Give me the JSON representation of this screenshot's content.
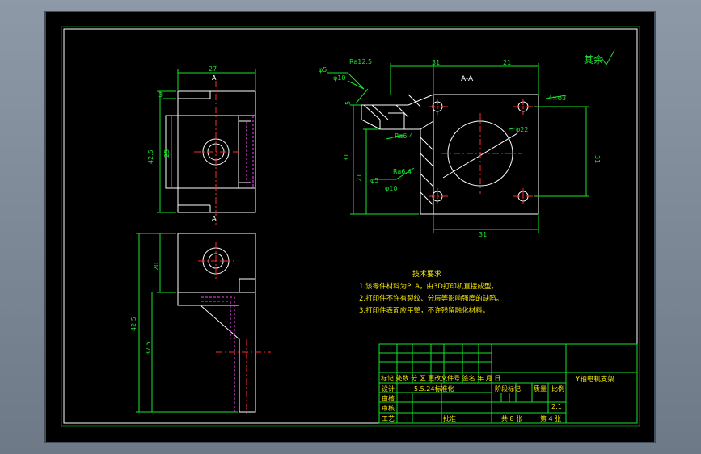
{
  "drawing": {
    "section_label": "A-A",
    "view_arrow_label": "A",
    "remaining_finish": "其余",
    "dimensions": {
      "top_width": "27",
      "top_d3": "3",
      "top_height": "42.5",
      "top_d25": "25",
      "side_20": "20",
      "side_42": "42.5",
      "side_37": "37.5",
      "sec_31a": "31",
      "sec_21a": "21",
      "sec_5": "5",
      "sec_31b": "31",
      "sec_21b": "21",
      "sec_31c": "31",
      "sec_31d": "31",
      "hole_4x": "4×φ3",
      "phi22": "φ22",
      "phi5a": "φ5",
      "phi10a": "φ10",
      "phi5b": "φ5",
      "phi10b": "φ10",
      "ra125": "Ra12.5",
      "ra64a": "Ra6.4",
      "ra64b": "Ra6.4"
    },
    "tech_title": "技术要求",
    "tech_notes": [
      "1.该零件材料为PLA，由3D打印机直接成型。",
      "2.打印件不许有裂纹、分层等影响强度的缺陷。",
      "3.打印件表面应平整，不许残留融化材料。"
    ]
  },
  "title_block": {
    "part_name": "Y轴电机支架",
    "header_row": "标记 处数 分 区 更改文件号 签名 年 月 日",
    "designer_label": "设计",
    "designer_info": "5.5.24标准化",
    "check_label": "审核",
    "process_label": "工艺",
    "approve_label": "批准",
    "stage_label": "阶段标记",
    "weight_label": "质量",
    "scale_label": "比例",
    "scale_value": "2:1",
    "sheets_total": "共 8 张",
    "sheet_no": "第 4 张",
    "extra_label": "审核"
  },
  "colors": {
    "background": "#000000",
    "frame": "#19e32b",
    "part_lines": "#ffffff",
    "center_lines": "#ff2a2a",
    "hidden_lines": "#ff3cff",
    "annotation_text": "#f5e700"
  }
}
